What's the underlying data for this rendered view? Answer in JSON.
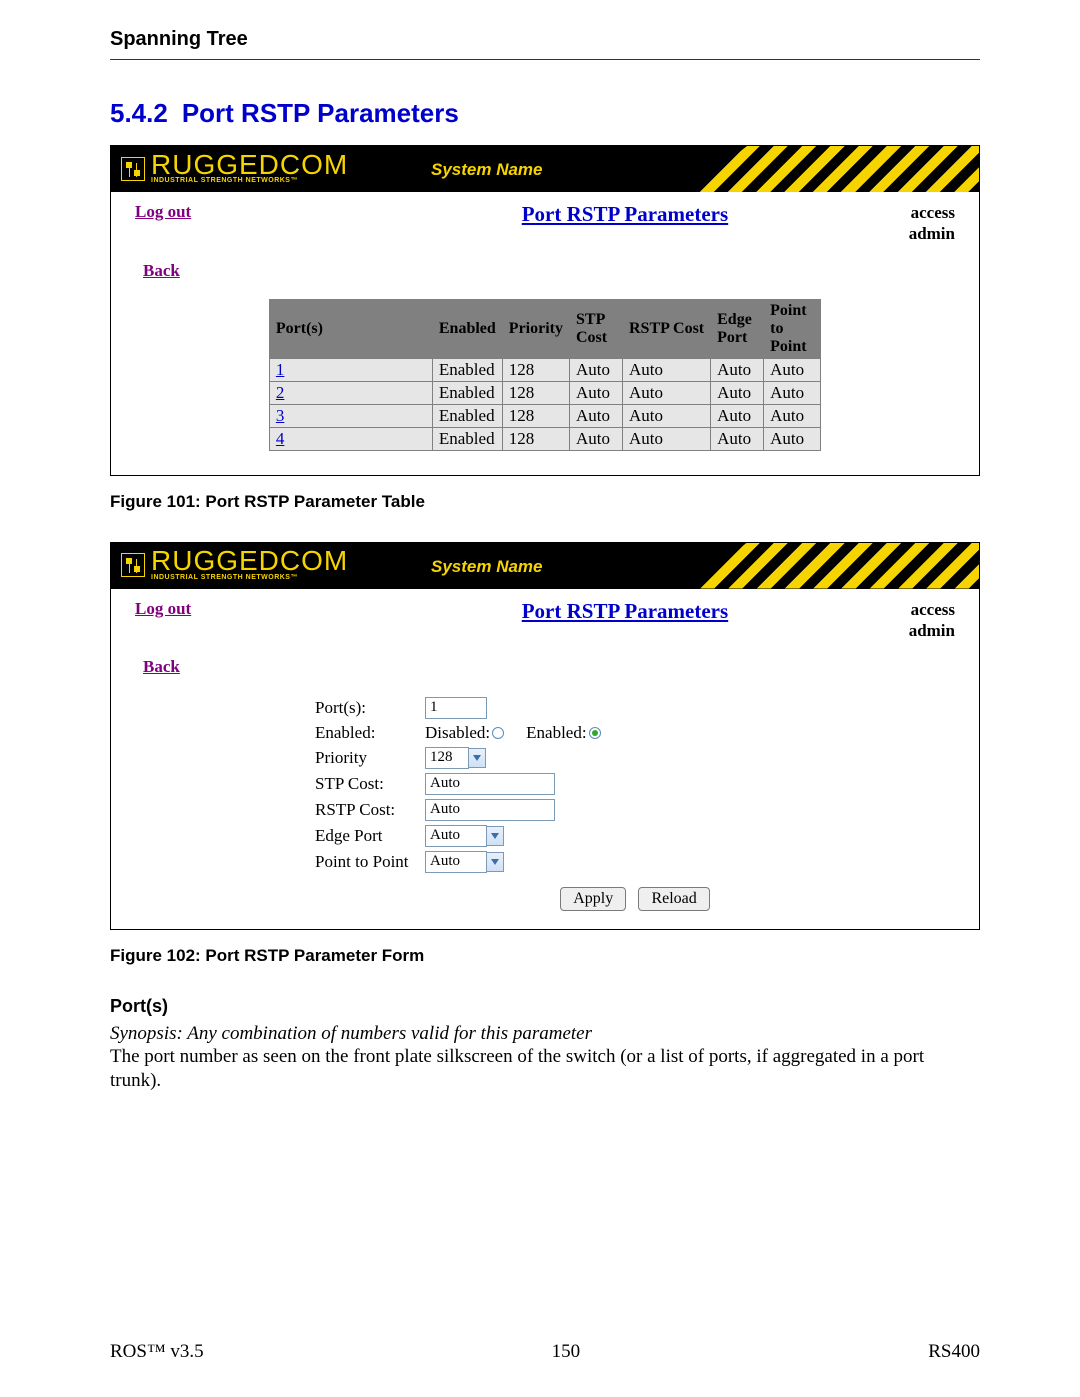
{
  "page_header": "Spanning Tree",
  "section_number": "5.4.2",
  "section_title": "Port RSTP Parameters",
  "branding": {
    "name": "RUGGEDCOM",
    "tagline": "INDUSTRIAL STRENGTH NETWORKS™"
  },
  "system_name_label": "System Name",
  "links": {
    "logout": "Log out",
    "back": "Back"
  },
  "panel_title": "Port RSTP Parameters",
  "access_line1": "access",
  "access_line2": "admin",
  "figure1_caption": "Figure 101: Port RSTP Parameter Table",
  "figure2_caption": "Figure 102: Port RSTP Parameter Form",
  "table": {
    "headers": [
      "Port(s)",
      "Enabled",
      "Priority",
      "STP Cost",
      "RSTP Cost",
      "Edge Port",
      "Point to Point"
    ],
    "rows": [
      {
        "port": "1",
        "enabled": "Enabled",
        "priority": "128",
        "stp": "Auto",
        "rstp": "Auto",
        "edge": "Auto",
        "ptp": "Auto"
      },
      {
        "port": "2",
        "enabled": "Enabled",
        "priority": "128",
        "stp": "Auto",
        "rstp": "Auto",
        "edge": "Auto",
        "ptp": "Auto"
      },
      {
        "port": "3",
        "enabled": "Enabled",
        "priority": "128",
        "stp": "Auto",
        "rstp": "Auto",
        "edge": "Auto",
        "ptp": "Auto"
      },
      {
        "port": "4",
        "enabled": "Enabled",
        "priority": "128",
        "stp": "Auto",
        "rstp": "Auto",
        "edge": "Auto",
        "ptp": "Auto"
      }
    ]
  },
  "form": {
    "labels": {
      "ports": "Port(s):",
      "enabled": "Enabled:",
      "priority": "Priority",
      "stp": "STP Cost:",
      "rstp": "RSTP Cost:",
      "edge": "Edge Port",
      "ptp": "Point to Point"
    },
    "values": {
      "ports": "1",
      "disabled_opt": "Disabled:",
      "enabled_opt": "Enabled:",
      "priority": "128",
      "stp": "Auto",
      "rstp": "Auto",
      "edge": "Auto",
      "ptp": "Auto"
    },
    "buttons": {
      "apply": "Apply",
      "reload": "Reload"
    }
  },
  "description": {
    "heading": "Port(s)",
    "synopsis": "Synopsis: Any combination of numbers valid for this parameter",
    "body": "The port number as seen on the front plate silkscreen of the switch (or a list of ports, if aggregated in a port trunk)."
  },
  "footer": {
    "left": "ROS™  v3.5",
    "center": "150",
    "right": "RS400"
  }
}
